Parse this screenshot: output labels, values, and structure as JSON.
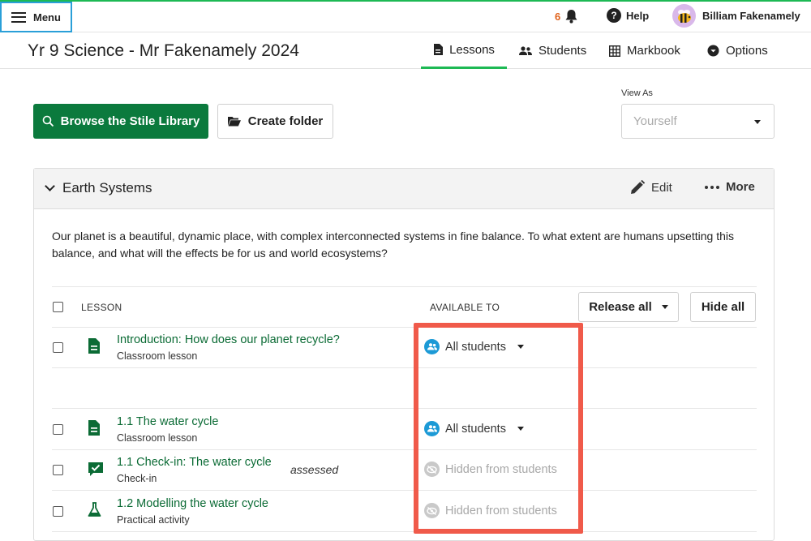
{
  "topbar": {
    "menu_label": "Menu",
    "notification_count": "6",
    "help_label": "Help",
    "user_name": "Billiam Fakenamely"
  },
  "course": {
    "title": "Yr 9 Science - Mr Fakenamely 2024",
    "tabs": [
      {
        "label": "Lessons",
        "icon": "document-icon",
        "active": true
      },
      {
        "label": "Students",
        "icon": "people-icon",
        "active": false
      },
      {
        "label": "Markbook",
        "icon": "grid-icon",
        "active": false
      },
      {
        "label": "Options",
        "icon": "chevron-circle-icon",
        "active": false
      }
    ]
  },
  "actions": {
    "browse_label": "Browse the Stile Library",
    "create_folder_label": "Create folder",
    "view_as_label": "View As",
    "view_as_placeholder": "Yourself"
  },
  "unit": {
    "title": "Earth Systems",
    "edit_label": "Edit",
    "more_label": "More",
    "description": "Our planet is a beautiful, dynamic place, with complex interconnected systems in fine balance. To what extent are humans upsetting this balance, and what will the effects be for us and world ecosystems?",
    "columns": {
      "lesson": "LESSON",
      "available_to": "AVAILABLE TO"
    },
    "release_all_label": "Release all",
    "hide_all_label": "Hide all",
    "lessons": [
      {
        "title": "Introduction: How does our planet recycle?",
        "type": "Classroom lesson",
        "icon": "document-icon",
        "availability": "All students",
        "assessed": ""
      },
      {
        "title": "1.1 The water cycle",
        "type": "Classroom lesson",
        "icon": "document-icon",
        "availability": "All students",
        "assessed": ""
      },
      {
        "title": "1.1 Check-in: The water cycle",
        "type": "Check-in",
        "icon": "checkbox-icon",
        "availability": "Hidden from students",
        "assessed": "assessed"
      },
      {
        "title": "1.2 Modelling the water cycle",
        "type": "Practical activity",
        "icon": "flask-icon",
        "availability": "Hidden from students",
        "assessed": ""
      }
    ]
  },
  "colors": {
    "accent": "#1db954",
    "primary_button": "#0b7a3d",
    "link": "#0b6b35",
    "highlight": "#f05a4a",
    "badge_all": "#1c9ad6"
  }
}
